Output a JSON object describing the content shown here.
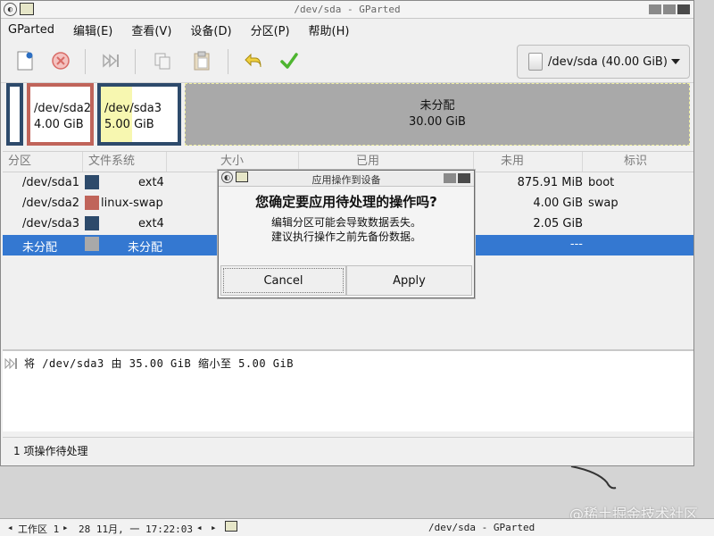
{
  "window": {
    "title": "/dev/sda - GParted"
  },
  "menu": [
    "GParted",
    "编辑(E)",
    "查看(V)",
    "设备(D)",
    "分区(P)",
    "帮助(H)"
  ],
  "toolbar": {
    "buttons": [
      "new-icon",
      "delete-icon",
      "resize-icon",
      "copy-icon",
      "paste-icon",
      "undo-icon",
      "apply-icon"
    ],
    "device": "/dev/sda (40.00 GiB)"
  },
  "map": [
    {
      "name": "",
      "size": "",
      "color": "#2d4a6b"
    },
    {
      "name": "/dev/sda2",
      "size": "4.00 GiB",
      "color": "#c0645a"
    },
    {
      "name": "/dev/sda3",
      "size": "5.00 GiB",
      "color": "#2d4a6b",
      "fill_color": "#f7f7b0",
      "used_fraction": 0.41
    },
    {
      "name": "未分配",
      "size": "30.00 GiB",
      "color": "#a9a9a9"
    }
  ],
  "table": {
    "headers": [
      "分区",
      "文件系统",
      "大小",
      "已用",
      "未用",
      "标识"
    ],
    "rows": [
      {
        "partition": "/dev/sda1",
        "fs": "ext4",
        "fs_color": "#2d4a6b",
        "unused": "875.91 MiB",
        "flags": "boot"
      },
      {
        "partition": "/dev/sda2",
        "fs": "linux-swap",
        "fs_color": "#c0645a",
        "unused": "4.00 GiB",
        "flags": "swap"
      },
      {
        "partition": "/dev/sda3",
        "fs": "ext4",
        "fs_color": "#2d4a6b",
        "unused": "2.05 GiB",
        "flags": ""
      },
      {
        "partition": "未分配",
        "fs": "未分配",
        "fs_color": "#a9a9a9",
        "unused": "---",
        "flags": ""
      }
    ]
  },
  "operations": {
    "line": "将 /dev/sda3 由 35.00 GiB 缩小至 5.00 GiB"
  },
  "status": "1 项操作待处理",
  "dialog": {
    "title": "应用操作到设备",
    "heading": "您确定要应用待处理的操作吗?",
    "message1": "编辑分区可能会导致数据丢失。",
    "message2": "建议执行操作之前先备份数据。",
    "cancel": "Cancel",
    "apply": "Apply"
  },
  "taskbar": {
    "workspace": "工作区 1",
    "datetime": "28 11月, 一 17:22:03",
    "window_title": "/dev/sda - GParted"
  },
  "watermark": "@稀土掘金技术社区"
}
